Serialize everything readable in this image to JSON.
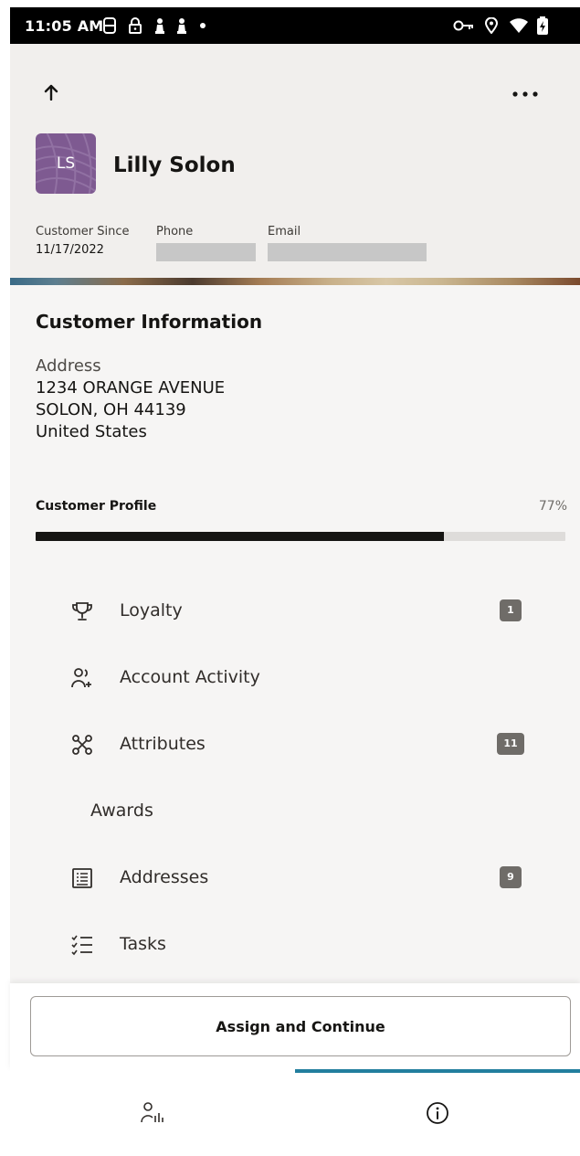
{
  "status_bar": {
    "time": "11:05 AM",
    "icons": [
      "sim-icon",
      "lock-icon",
      "pawn-icon",
      "pawn-icon",
      "dot-icon",
      "key-icon",
      "location-icon",
      "wifi-icon",
      "battery-icon"
    ]
  },
  "header": {
    "avatar_initials": "LS",
    "name": "Lilly Solon",
    "customer_since_label": "Customer Since",
    "customer_since_value": "11/17/2022",
    "phone_label": "Phone",
    "email_label": "Email",
    "avatar_color": "#7e5a91"
  },
  "customer_info": {
    "title": "Customer Information",
    "address_label": "Address",
    "address_lines": [
      "1234 ORANGE AVENUE",
      "SOLON, OH 44139",
      "United States"
    ]
  },
  "profile": {
    "label": "Customer Profile",
    "percent_text": "77%",
    "percent": 77
  },
  "menu": [
    {
      "label": "Loyalty",
      "icon": "trophy-icon",
      "badge": "1"
    },
    {
      "label": "Account Activity",
      "icon": "users-icon",
      "badge": ""
    },
    {
      "label": "Attributes",
      "icon": "network-icon",
      "badge": "11"
    },
    {
      "label": "Awards",
      "icon": "",
      "badge": ""
    },
    {
      "label": "Addresses",
      "icon": "address-list-icon",
      "badge": "9"
    },
    {
      "label": "Tasks",
      "icon": "tasks-icon",
      "badge": ""
    }
  ],
  "action": {
    "assign_label": "Assign and Continue"
  },
  "tabs": [
    {
      "icon": "customer-stats-icon",
      "selected": false
    },
    {
      "icon": "info-icon",
      "selected": true
    }
  ],
  "colors": {
    "accent": "#227e9e",
    "badge": "#6f6c68",
    "header_bg": "#f1efed"
  }
}
